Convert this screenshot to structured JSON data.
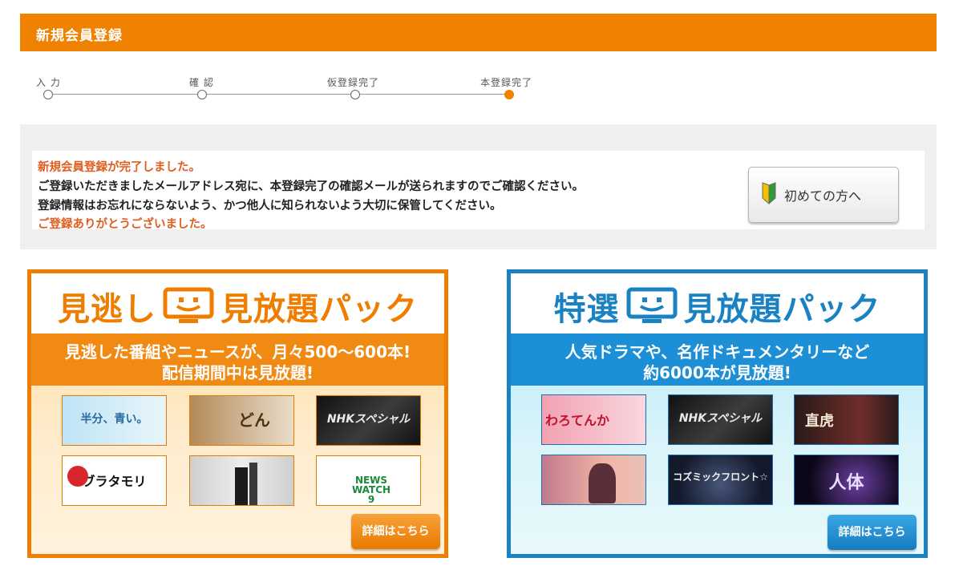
{
  "header": {
    "title": "新規会員登録"
  },
  "steps": [
    {
      "label": "入 力",
      "state": "pending"
    },
    {
      "label": "確 認",
      "state": "pending"
    },
    {
      "label": "仮登録完了",
      "state": "pending"
    },
    {
      "label": "本登録完了",
      "state": "current"
    }
  ],
  "message": {
    "completed": "新規会員登録が完了しました。",
    "line_email": "ご登録いただきましたメールアドレス宛に、本登録完了の確認メールが送られますのでご確認ください。",
    "line_keep": "登録情報はお忘れにならないよう、かつ他人に知られないよう大切に保管してください。",
    "thanks": "ご登録ありがとうございました。"
  },
  "first_time_button": {
    "label": "初めての方へ",
    "icon": "beginner-leaf-icon"
  },
  "packs": {
    "missed": {
      "title_left": "見逃し",
      "title_right": "見放題パック",
      "sub_line1": "見逃した番組やニュースが、月々500〜600本!",
      "sub_line2": "配信期間中は見放題!",
      "thumbs": [
        "半分、青い。",
        "どん",
        "NHKスペシャル",
        "ブラタモリ",
        "",
        "NEWS WATCH 9"
      ],
      "detail_button": "詳細はこちら",
      "color": "#ef7d00"
    },
    "special": {
      "title_left": "特選",
      "title_right": "見放題パック",
      "sub_line1": "人気ドラマや、名作ドキュメンタリーなど",
      "sub_line2": "約6000本が見放題!",
      "thumbs": [
        "わろてんか",
        "NHKスペシャル",
        "直虎",
        "",
        "コズミックフロント☆",
        "人体"
      ],
      "detail_button": "詳細はこちら",
      "color": "#1a82c3"
    }
  }
}
